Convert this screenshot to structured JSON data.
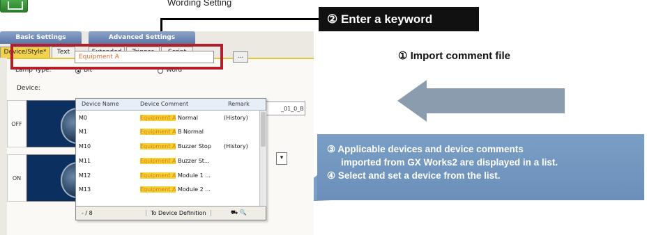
{
  "header": {
    "top_text": "Wording Setting"
  },
  "callouts": {
    "keyword": "② Enter a keyword",
    "import": "① Import comment file",
    "info_lines": [
      "③ Applicable devices and device comments",
      "imported from GX Works2 are displayed in a list.",
      "④ Select and set a device from the list."
    ]
  },
  "dialog": {
    "tab_groups": [
      "Basic Settings",
      "Advanced Settings"
    ],
    "tabs": [
      "Device/Style*",
      "Text",
      "Extended",
      "Trigger",
      "Script"
    ],
    "lamp_type_label": "Lamp Type:",
    "radio_bit": "Bit",
    "radio_word": "Word",
    "device_label": "Device:",
    "device_value": "Equipment A",
    "browse_label": "...",
    "state_off": "OFF",
    "state_on": "ON",
    "right_text": "_01_0_B",
    "combo_arrow": "▾"
  },
  "device_list": {
    "columns": [
      "Device Name",
      "Device Comment",
      "Remark"
    ],
    "rows": [
      {
        "name": "M0",
        "hl": "Equipment A",
        "rest": " Normal",
        "remark": "(History)"
      },
      {
        "name": "M1",
        "hl": "Equipment A",
        "rest": " B Normal",
        "remark": ""
      },
      {
        "name": "M10",
        "hl": "Equipment A",
        "rest": " Buzzer Stop",
        "remark": "(History)"
      },
      {
        "name": "M11",
        "hl": "Equipment A",
        "rest": " Buzzer St...",
        "remark": ""
      },
      {
        "name": "M12",
        "hl": "Equipment A",
        "rest": " Module 1 ...",
        "remark": ""
      },
      {
        "name": "M13",
        "hl": "Equipment A",
        "rest": " Module 2 ...",
        "remark": ""
      }
    ],
    "footer_count": "- / 8",
    "footer_button": "To Device Definition",
    "footer_icons": "⛟ 🔍"
  },
  "colors": {
    "highlight": "#f4d22d",
    "red_frame": "#b21e2a",
    "info_panel": "#6b8fb9"
  }
}
